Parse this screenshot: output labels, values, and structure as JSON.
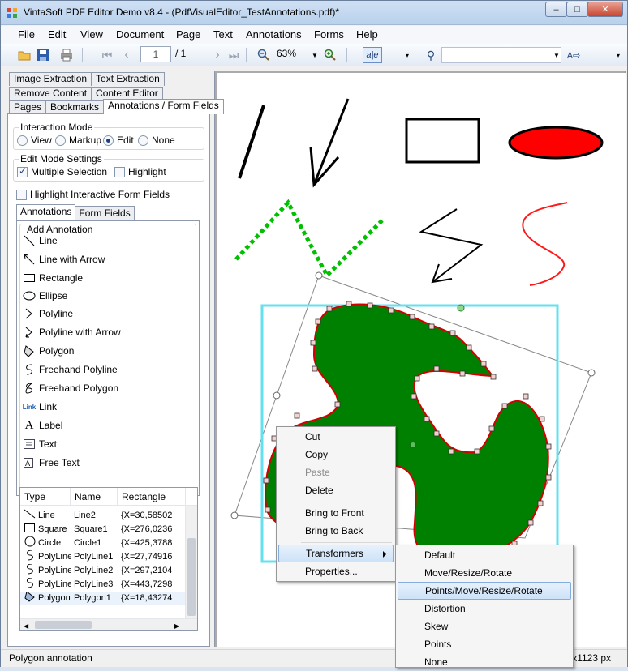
{
  "window": {
    "title": "VintaSoft PDF Editor Demo v8.4 -  (PdfVisualEditor_TestAnnotations.pdf)*",
    "minimize": "–",
    "maximize": "□",
    "close": "✕"
  },
  "menu": [
    "File",
    "Edit",
    "View",
    "Document",
    "Page",
    "Text",
    "Annotations",
    "Forms",
    "Help"
  ],
  "toolbar": {
    "page_current": "1",
    "page_total": "/ 1",
    "zoom": "63%",
    "search_value": ""
  },
  "tabs_row1": [
    "Image Extraction",
    "Text Extraction"
  ],
  "tabs_row2": [
    "Remove Content",
    "Content Editor"
  ],
  "tabs_row3": [
    "Pages",
    "Bookmarks",
    "Annotations / Form Fields"
  ],
  "interaction_mode": {
    "title": "Interaction Mode",
    "options": [
      "View",
      "Markup",
      "Edit",
      "None"
    ],
    "selected": "Edit"
  },
  "edit_settings": {
    "title": "Edit Mode Settings",
    "multiple_selection": "Multiple Selection",
    "highlight": "Highlight"
  },
  "highlight_fields": "Highlight Interactive Form  Fields",
  "subtabs": [
    "Annotations",
    "Form Fields"
  ],
  "add_annotation": {
    "title": "Add Annotation",
    "items": [
      "Line",
      "Line with Arrow",
      "Rectangle",
      "Ellipse",
      "Polyline",
      "Polyline with Arrow",
      "Polygon",
      "Freehand Polyline",
      "Freehand Polygon",
      "Link",
      "Label",
      "Text",
      "Free Text"
    ]
  },
  "list": {
    "columns": [
      "Type",
      "Name",
      "Rectangle"
    ],
    "rows": [
      {
        "type": "Line",
        "name": "Line2",
        "rect": "{X=30,58502"
      },
      {
        "type": "Square",
        "name": "Square1",
        "rect": "{X=276,0236"
      },
      {
        "type": "Circle",
        "name": "Circle1",
        "rect": "{X=425,3788"
      },
      {
        "type": "PolyLine",
        "name": "PolyLine1",
        "rect": "{X=27,74916"
      },
      {
        "type": "PolyLine",
        "name": "PolyLine2",
        "rect": "{X=297,2104"
      },
      {
        "type": "PolyLine",
        "name": "PolyLine3",
        "rect": "{X=443,7298"
      },
      {
        "type": "Polygon",
        "name": "Polygon1",
        "rect": "{X=18,43274"
      }
    ]
  },
  "context_menu": [
    "Cut",
    "Copy",
    "Paste",
    "Delete",
    "Bring to Front",
    "Bring to Back",
    "Transformers",
    "Properties..."
  ],
  "transformers_menu": [
    "Default",
    "Move/Resize/Rotate",
    "Points/Move/Resize/Rotate",
    "Distortion",
    "Skew",
    "Points",
    "None"
  ],
  "status": {
    "left": "Polygon annotation",
    "right": "x1123 px"
  },
  "colors": {
    "ellipse_fill": "#ff0000",
    "polygon_fill": "#008000",
    "dotted_line": "#00c000",
    "selection": "#66e0f0"
  }
}
